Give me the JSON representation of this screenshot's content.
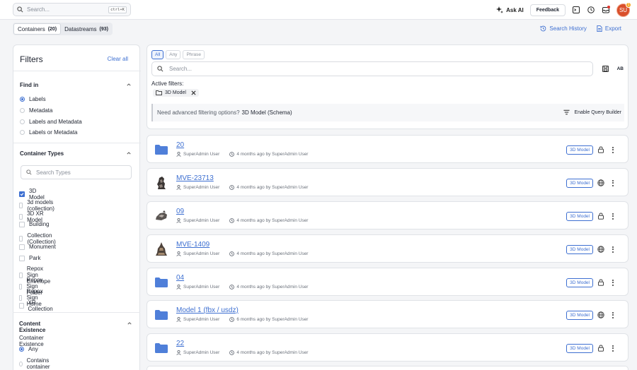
{
  "topbar": {
    "search_placeholder": "Search...",
    "search_shortcut": "ctrl+K",
    "ask_ai": "Ask AI",
    "feedback": "Feedback",
    "avatar_initials": "SU",
    "avatar_badge": "1"
  },
  "tabs": [
    {
      "label": "Containers",
      "count": "(20)"
    },
    {
      "label": "Datastreams",
      "count": "(93)"
    }
  ],
  "links": {
    "search_history": "Search History",
    "export": "Export"
  },
  "filters": {
    "title": "Filters",
    "clear_all": "Clear all",
    "find_in": {
      "title": "Find in",
      "options": [
        "Labels",
        "Metadata",
        "Labels and Metadata",
        "Labels or Metadata"
      ],
      "selected": "Labels"
    },
    "container_types": {
      "title": "Container Types",
      "search_placeholder": "Search Types",
      "options": [
        "3D Model",
        "3d models (collection)",
        "3D XR Model",
        "Building",
        "Collection (Collection)",
        "Monument",
        "Park",
        "Repox Sign Envelope",
        "Repox Sign Folder",
        "Repox Sign Home",
        "XR Collection"
      ],
      "checked": [
        "3D Model"
      ]
    },
    "content_existence": {
      "title": "Content Existence",
      "subtitle": "Container Existence",
      "options": [
        "Any",
        "Contains container"
      ],
      "selected": "Any"
    }
  },
  "query": {
    "modes": [
      "All",
      "Any",
      "Phrase"
    ],
    "active_mode": "All",
    "search_placeholder": "Search...",
    "ab_label": "AB",
    "active_filters_label": "Active filters:",
    "chip_label": "3D Model",
    "advanced_text": "Need advanced filtering options?",
    "advanced_link": "3D Model (Schema)",
    "query_builder": "Enable Query Builder"
  },
  "results": [
    {
      "title": "20",
      "owner": "SuperAdmin User",
      "modified": "4 months ago by SuperAdmin User",
      "tag": "3D Model",
      "thumb": "folder-icon",
      "access": "lock-icon"
    },
    {
      "title": "MVE-23713",
      "owner": "SuperAdmin User",
      "modified": "4 months ago by SuperAdmin User",
      "tag": "3D Model",
      "thumb": "model-thumbnail",
      "access": "globe-icon"
    },
    {
      "title": "09",
      "owner": "SuperAdmin User",
      "modified": "4 months ago by SuperAdmin User",
      "tag": "3D Model",
      "thumb": "model-thumbnail",
      "access": "lock-icon"
    },
    {
      "title": "MVE-1409",
      "owner": "SuperAdmin User",
      "modified": "4 months ago by SuperAdmin User",
      "tag": "3D Model",
      "thumb": "model-thumbnail",
      "access": "globe-icon"
    },
    {
      "title": "04",
      "owner": "SuperAdmin User",
      "modified": "4 months ago by SuperAdmin User",
      "tag": "3D Model",
      "thumb": "folder-icon",
      "access": "lock-icon"
    },
    {
      "title": "Model 1 (fbx / usdz)",
      "owner": "SuperAdmin User",
      "modified": "6 months ago by SuperAdmin User",
      "tag": "3D Model",
      "thumb": "folder-icon",
      "access": "globe-icon"
    },
    {
      "title": "22",
      "owner": "SuperAdmin User",
      "modified": "4 months ago by SuperAdmin User",
      "tag": "3D Model",
      "thumb": "folder-icon",
      "access": "lock-icon"
    }
  ],
  "colors": {
    "accent": "#3d6fd1",
    "folder": "#4f7fd9",
    "avatar": "#d94f2b"
  }
}
